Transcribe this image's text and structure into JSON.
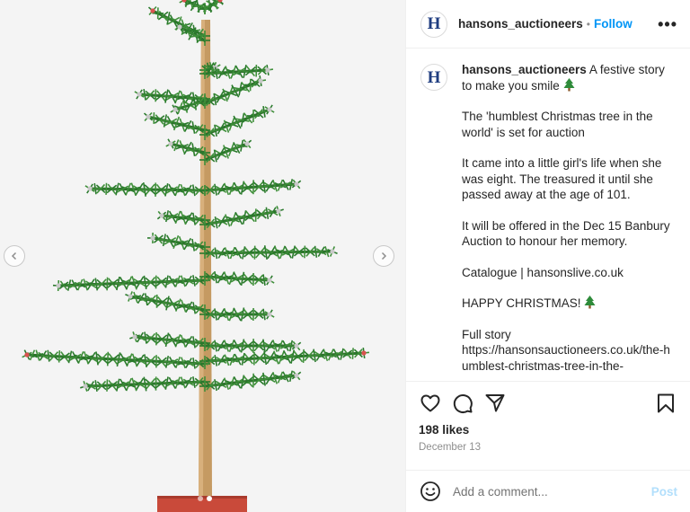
{
  "post": {
    "username": "hansons_auctioneers",
    "avatar_letter": "H",
    "separator": "•",
    "follow_label": "Follow",
    "more_label": "•••"
  },
  "caption": {
    "username": "hansons_auctioneers",
    "first_line": "A festive story to make you smile",
    "paragraphs": [
      "The 'humblest Christmas tree in the world' is set for auction",
      "It came into a little girl's life when she was eight. The treasured it until she passed away at the age of 101.",
      "It will be offered in the Dec 15 Banbury Auction to honour her memory.",
      "Catalogue | hansonslive.co.uk",
      "HAPPY CHRISTMAS!"
    ],
    "full_story_label": "Full story",
    "url": "https://hansonsauctioneers.co.uk/the-humblest-christmas-tree-in-the-"
  },
  "engagement": {
    "likes": "198 likes",
    "date": "December 13"
  },
  "comment": {
    "placeholder": "Add a comment...",
    "post_label": "Post"
  },
  "carousel": {
    "slide_count": 2,
    "active_slide": 2
  },
  "colors": {
    "accent": "#0095f6",
    "post_disabled": "#b2dffc",
    "brand_logo": "#1f3d80",
    "tree_green": "#3f8f3a"
  }
}
